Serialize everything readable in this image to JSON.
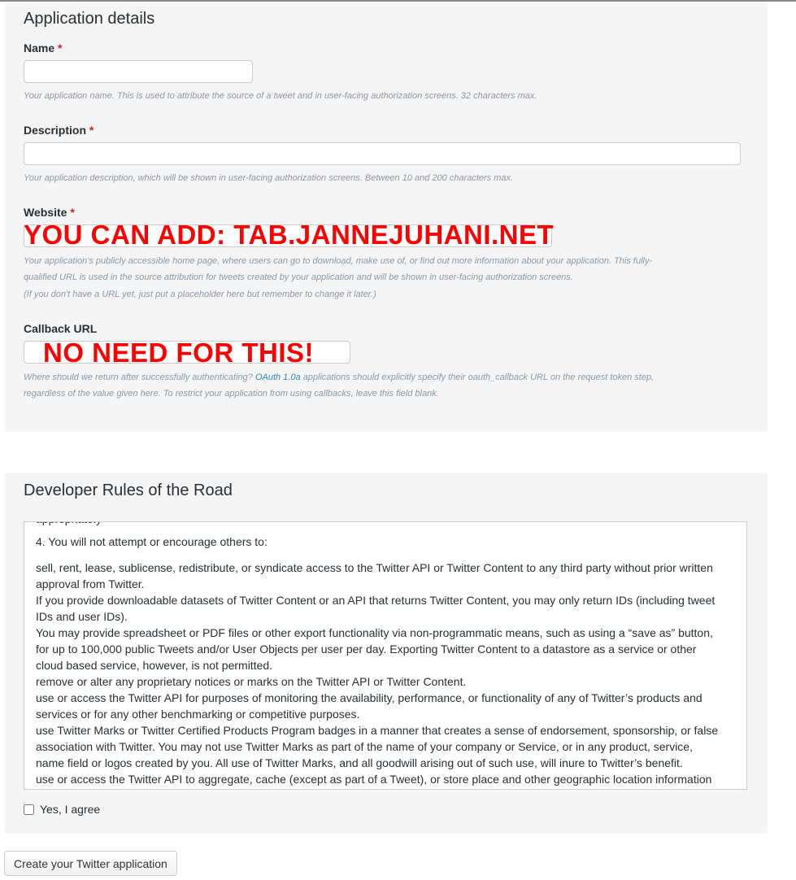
{
  "details": {
    "title": "Application details",
    "name": {
      "label": "Name",
      "required_mark": "*",
      "value": "",
      "hint": "Your application name. This is used to attribute the source of a tweet and in user-facing authorization screens. 32 characters max."
    },
    "description": {
      "label": "Description",
      "required_mark": "*",
      "value": "",
      "hint": "Your application description, which will be shown in user-facing authorization screens. Between 10 and 200 characters max."
    },
    "website": {
      "label": "Website",
      "required_mark": "*",
      "value": "",
      "overlay": "YOU CAN ADD: TAB.JANNEJUHANI.NET",
      "hint_line1": "Your application's publicly accessible home page, where users can go to download, make use of, or find out more information about your application. This fully-",
      "hint_line2": "qualified URL is used in the source attribution for tweets created by your application and will be shown in user-facing authorization screens.",
      "hint_line3": "(If you don't have a URL yet, just put a placeholder here but remember to change it later.)"
    },
    "callback": {
      "label": "Callback URL",
      "value": "",
      "overlay": "NO NEED FOR THIS!",
      "hint_before_link": "Where should we return after successfully authenticating? ",
      "hint_link": "OAuth 1.0a",
      "hint_after_link": " applications should explicitly specify their oauth_callback URL on the request token step,",
      "hint_line2": "regardless of the value given here. To restrict your application from using callbacks, leave this field blank."
    }
  },
  "rules": {
    "title": "Developer Rules of the Road",
    "cut_line": "appropriately",
    "heading": "4. You will not attempt or encourage others to:",
    "lines": [
      "sell, rent, lease, sublicense, redistribute, or syndicate access to the Twitter API or Twitter Content to any third party without prior written",
      "approval from Twitter.",
      "If you provide downloadable datasets of Twitter Content or an API that returns Twitter Content, you may only return IDs (including tweet",
      "IDs and user IDs).",
      "You may provide spreadsheet or PDF files or other export functionality via non-programmatic means, such as using a “save as” button,",
      "for up to 100,000 public Tweets and/or User Objects per user per day. Exporting Twitter Content to a datastore as a service or other",
      "cloud based service, however, is not permitted.",
      "remove or alter any proprietary notices or marks on the Twitter API or Twitter Content.",
      "use or access the Twitter API for purposes of monitoring the availability, performance, or functionality of any of Twitter’s products and",
      "services or for any other benchmarking or competitive purposes.",
      "use Twitter Marks or Twitter Certified Products Program badges in a manner that creates a sense of endorsement, sponsorship, or false",
      "association with Twitter. You may not use Twitter Marks as part of the name of your company or Service, or in any product, service,",
      "name field or logos created by you. All use of Twitter Marks, and all goodwill arising out of such use, will inure to Twitter’s benefit.",
      "use or access the Twitter API to aggregate, cache (except as part of a Tweet), or store place and other geographic location information"
    ],
    "agree_label": "Yes, I agree",
    "agree_checked": false
  },
  "submit_label": "Create your Twitter application"
}
